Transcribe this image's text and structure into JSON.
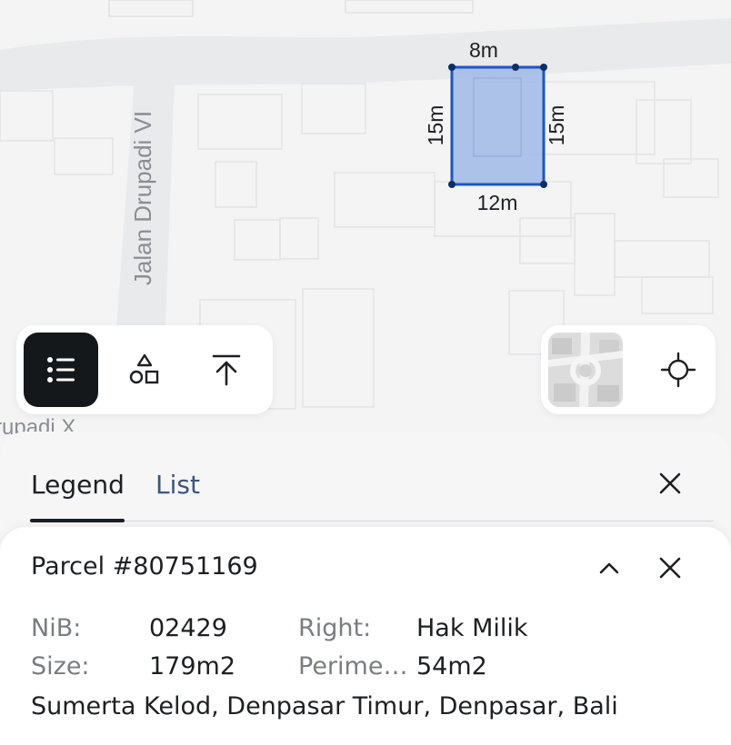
{
  "map": {
    "street_labels": [
      "Jalan Drupadi VI",
      "rupadi X"
    ],
    "measurements": {
      "top": "8m",
      "bottom": "12m",
      "left": "15m",
      "right": "15m"
    },
    "parcel_fill_color": "#9fb9e6",
    "parcel_stroke_color": "#1b56c7"
  },
  "toolbar": {
    "legend_icon": "list-icon",
    "shapes_icon": "shapes-icon",
    "upload_icon": "upload-icon",
    "active_tool": "legend"
  },
  "map_controls": {
    "basemap_icon": "basemap-thumbnail",
    "locate_icon": "crosshair-icon"
  },
  "panel": {
    "tabs": [
      {
        "label": "Legend",
        "active": true
      },
      {
        "label": "List",
        "active": false
      }
    ],
    "parcel": {
      "title": "Parcel #80751169",
      "nib_label": "NiB:",
      "nib_value": "02429",
      "right_label": "Right:",
      "right_value": "Hak Milik",
      "size_label": "Size:",
      "size_value": "179m2",
      "perimeter_label": "Perimeter:",
      "perimeter_value": "54m2",
      "address": "Sumerta Kelod, Denpasar Timur, Denpasar, Bali"
    }
  },
  "colors": {
    "accent_dark": "#15181b",
    "tab_inactive": "#3c5677",
    "label_gray": "#7a7c80"
  }
}
